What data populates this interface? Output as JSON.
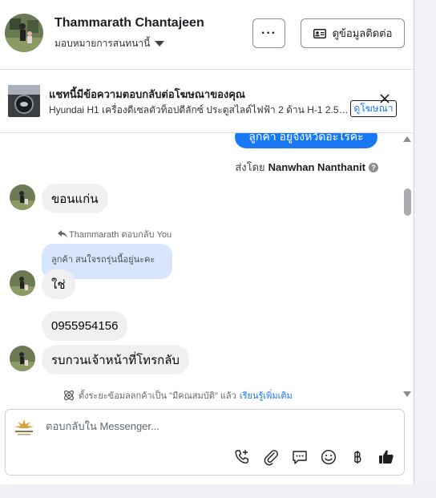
{
  "header": {
    "contact_name": "Thammarath Chantajeen",
    "assign_label": "มอบหมายการสนทนานี้",
    "more_label": "···",
    "contact_info_button": "ดูข้อมูลติดต่อ"
  },
  "ad_banner": {
    "title": "แชทนี้มีข้อความตอบกลับต่อโฆษณาของคุณ",
    "description": "Hyundai H1 เครื่องดีเซลตัวท็อปดีลักซ์ ประตูสไลด์ไฟฟ้า 2 ด้าน H-1 2.5 D...",
    "view_ad_link": "ดูโฆษณา"
  },
  "conversation": {
    "outgoing_message": "ลูกค้า อยู่จังหวัดอะไรคะ",
    "sent_by_prefix": "ส่งโดย",
    "sent_by_name": "Nanwhan Nanthanit",
    "incoming_1": "ขอนแก่น",
    "reply_note": "Thammarath ตอบกลับ You",
    "quoted_text": "ลูกค้า สนใจรถรุ่นนี้อยู่นะคะ",
    "incoming_2": "ใช่",
    "incoming_3": "0955954156",
    "incoming_4": "รบกวนเจ้าหน้าที่โทรกลับ",
    "notice_text": "ตั้งระยะข้อมลลกค้าเป็น \"มีคณสมบัติ\" แล้ว",
    "learn_more": "เรียนรู้เพิ่มเติม"
  },
  "composer": {
    "placeholder": "ตอบกลับใน Messenger..."
  },
  "icons": [
    "phone-plus-icon",
    "paperclip-icon",
    "speech-bubble-icon",
    "smiley-icon",
    "baht-icon",
    "thumbs-up-icon"
  ],
  "colors": {
    "accent": "#1877f2",
    "bubble_grey": "#f0f0f0",
    "quote_bg": "#d8e6fb"
  }
}
